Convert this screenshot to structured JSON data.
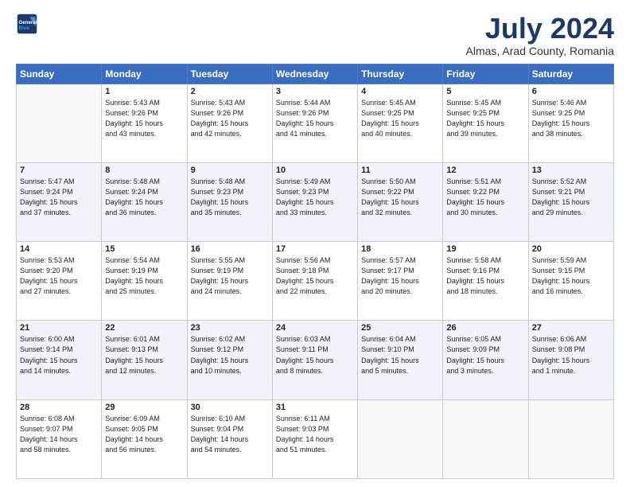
{
  "header": {
    "logo_line1": "General",
    "logo_line2": "Blue",
    "month": "July 2024",
    "location": "Almas, Arad County, Romania"
  },
  "weekdays": [
    "Sunday",
    "Monday",
    "Tuesday",
    "Wednesday",
    "Thursday",
    "Friday",
    "Saturday"
  ],
  "rows": [
    [
      {
        "num": "",
        "info": ""
      },
      {
        "num": "1",
        "info": "Sunrise: 5:43 AM\nSunset: 9:26 PM\nDaylight: 15 hours\nand 43 minutes."
      },
      {
        "num": "2",
        "info": "Sunrise: 5:43 AM\nSunset: 9:26 PM\nDaylight: 15 hours\nand 42 minutes."
      },
      {
        "num": "3",
        "info": "Sunrise: 5:44 AM\nSunset: 9:26 PM\nDaylight: 15 hours\nand 41 minutes."
      },
      {
        "num": "4",
        "info": "Sunrise: 5:45 AM\nSunset: 9:25 PM\nDaylight: 15 hours\nand 40 minutes."
      },
      {
        "num": "5",
        "info": "Sunrise: 5:45 AM\nSunset: 9:25 PM\nDaylight: 15 hours\nand 39 minutes."
      },
      {
        "num": "6",
        "info": "Sunrise: 5:46 AM\nSunset: 9:25 PM\nDaylight: 15 hours\nand 38 minutes."
      }
    ],
    [
      {
        "num": "7",
        "info": "Sunrise: 5:47 AM\nSunset: 9:24 PM\nDaylight: 15 hours\nand 37 minutes."
      },
      {
        "num": "8",
        "info": "Sunrise: 5:48 AM\nSunset: 9:24 PM\nDaylight: 15 hours\nand 36 minutes."
      },
      {
        "num": "9",
        "info": "Sunrise: 5:48 AM\nSunset: 9:23 PM\nDaylight: 15 hours\nand 35 minutes."
      },
      {
        "num": "10",
        "info": "Sunrise: 5:49 AM\nSunset: 9:23 PM\nDaylight: 15 hours\nand 33 minutes."
      },
      {
        "num": "11",
        "info": "Sunrise: 5:50 AM\nSunset: 9:22 PM\nDaylight: 15 hours\nand 32 minutes."
      },
      {
        "num": "12",
        "info": "Sunrise: 5:51 AM\nSunset: 9:22 PM\nDaylight: 15 hours\nand 30 minutes."
      },
      {
        "num": "13",
        "info": "Sunrise: 5:52 AM\nSunset: 9:21 PM\nDaylight: 15 hours\nand 29 minutes."
      }
    ],
    [
      {
        "num": "14",
        "info": "Sunrise: 5:53 AM\nSunset: 9:20 PM\nDaylight: 15 hours\nand 27 minutes."
      },
      {
        "num": "15",
        "info": "Sunrise: 5:54 AM\nSunset: 9:19 PM\nDaylight: 15 hours\nand 25 minutes."
      },
      {
        "num": "16",
        "info": "Sunrise: 5:55 AM\nSunset: 9:19 PM\nDaylight: 15 hours\nand 24 minutes."
      },
      {
        "num": "17",
        "info": "Sunrise: 5:56 AM\nSunset: 9:18 PM\nDaylight: 15 hours\nand 22 minutes."
      },
      {
        "num": "18",
        "info": "Sunrise: 5:57 AM\nSunset: 9:17 PM\nDaylight: 15 hours\nand 20 minutes."
      },
      {
        "num": "19",
        "info": "Sunrise: 5:58 AM\nSunset: 9:16 PM\nDaylight: 15 hours\nand 18 minutes."
      },
      {
        "num": "20",
        "info": "Sunrise: 5:59 AM\nSunset: 9:15 PM\nDaylight: 15 hours\nand 16 minutes."
      }
    ],
    [
      {
        "num": "21",
        "info": "Sunrise: 6:00 AM\nSunset: 9:14 PM\nDaylight: 15 hours\nand 14 minutes."
      },
      {
        "num": "22",
        "info": "Sunrise: 6:01 AM\nSunset: 9:13 PM\nDaylight: 15 hours\nand 12 minutes."
      },
      {
        "num": "23",
        "info": "Sunrise: 6:02 AM\nSunset: 9:12 PM\nDaylight: 15 hours\nand 10 minutes."
      },
      {
        "num": "24",
        "info": "Sunrise: 6:03 AM\nSunset: 9:11 PM\nDaylight: 15 hours\nand 8 minutes."
      },
      {
        "num": "25",
        "info": "Sunrise: 6:04 AM\nSunset: 9:10 PM\nDaylight: 15 hours\nand 5 minutes."
      },
      {
        "num": "26",
        "info": "Sunrise: 6:05 AM\nSunset: 9:09 PM\nDaylight: 15 hours\nand 3 minutes."
      },
      {
        "num": "27",
        "info": "Sunrise: 6:06 AM\nSunset: 9:08 PM\nDaylight: 15 hours\nand 1 minute."
      }
    ],
    [
      {
        "num": "28",
        "info": "Sunrise: 6:08 AM\nSunset: 9:07 PM\nDaylight: 14 hours\nand 58 minutes."
      },
      {
        "num": "29",
        "info": "Sunrise: 6:09 AM\nSunset: 9:05 PM\nDaylight: 14 hours\nand 56 minutes."
      },
      {
        "num": "30",
        "info": "Sunrise: 6:10 AM\nSunset: 9:04 PM\nDaylight: 14 hours\nand 54 minutes."
      },
      {
        "num": "31",
        "info": "Sunrise: 6:11 AM\nSunset: 9:03 PM\nDaylight: 14 hours\nand 51 minutes."
      },
      {
        "num": "",
        "info": ""
      },
      {
        "num": "",
        "info": ""
      },
      {
        "num": "",
        "info": ""
      }
    ]
  ]
}
